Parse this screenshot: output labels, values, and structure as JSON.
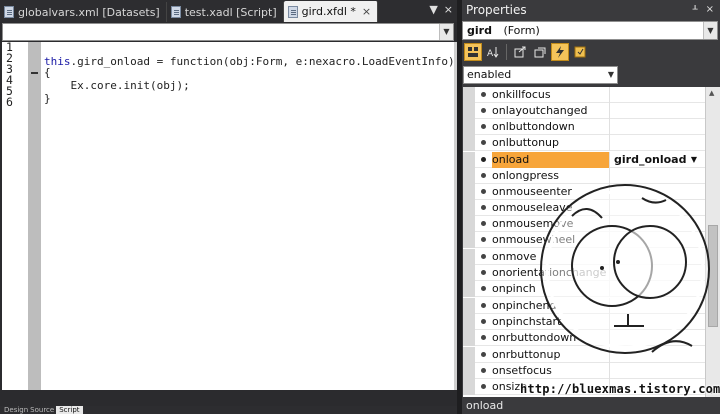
{
  "editor": {
    "tabs": [
      {
        "label": "globalvars.xml [Datasets]",
        "active": false
      },
      {
        "label": "test.xadl [Script]",
        "active": false
      },
      {
        "label": "gird.xfdl *",
        "active": true
      }
    ],
    "tab_close": "×",
    "pane_tools": [
      "▼",
      "×"
    ],
    "line_numbers": [
      "1",
      "2",
      "3",
      "4",
      "5",
      "6"
    ],
    "code_lines": [
      {
        "prefix": "",
        "kw": "",
        "rest": ""
      },
      {
        "prefix": "",
        "kw": "this",
        "rest": ".gird_onload = function(obj:Form, e:nexacro.LoadEventInfo)"
      },
      {
        "prefix": "",
        "kw": "",
        "rest": "{"
      },
      {
        "prefix": "    ",
        "kw": "",
        "rest": "Ex.core.init(obj);"
      },
      {
        "prefix": "",
        "kw": "",
        "rest": "}"
      },
      {
        "prefix": "",
        "kw": "",
        "rest": ""
      }
    ],
    "bottom_tabs": [
      "Design",
      "Source",
      "Script"
    ]
  },
  "properties": {
    "title": "Properties",
    "title_tools": [
      "ᚆ",
      "×"
    ],
    "object_name": "gird",
    "object_type": "(Form)",
    "filter_value": "enabled",
    "toolbar_icons": [
      "categorized-icon",
      "alphabetical-icon",
      "properties-icon",
      "events-icon",
      "lightning-icon",
      "refresh-icon"
    ],
    "events": [
      {
        "name": "onkillfocus",
        "value": ""
      },
      {
        "name": "onlayoutchanged",
        "value": ""
      },
      {
        "name": "onlbuttondown",
        "value": ""
      },
      {
        "name": "onlbuttonup",
        "value": ""
      },
      {
        "name": "onload",
        "value": "gird_onload",
        "selected": true
      },
      {
        "name": "onlongpress",
        "value": ""
      },
      {
        "name": "onmouseenter",
        "value": ""
      },
      {
        "name": "onmouseleave",
        "value": ""
      },
      {
        "name": "onmousemove",
        "value": ""
      },
      {
        "name": "onmousewheel",
        "value": ""
      },
      {
        "name": "onmove",
        "value": ""
      },
      {
        "name": "onorientationchange",
        "value": ""
      },
      {
        "name": "onpinch",
        "value": ""
      },
      {
        "name": "onpinchend",
        "value": ""
      },
      {
        "name": "onpinchstart",
        "value": ""
      },
      {
        "name": "onrbuttondown",
        "value": ""
      },
      {
        "name": "onrbuttonup",
        "value": ""
      },
      {
        "name": "onsetfocus",
        "value": ""
      },
      {
        "name": "onsize",
        "value": ""
      }
    ],
    "status_text": "onload"
  },
  "watermark": {
    "url": "http://bluexmas.tistory.com/"
  }
}
